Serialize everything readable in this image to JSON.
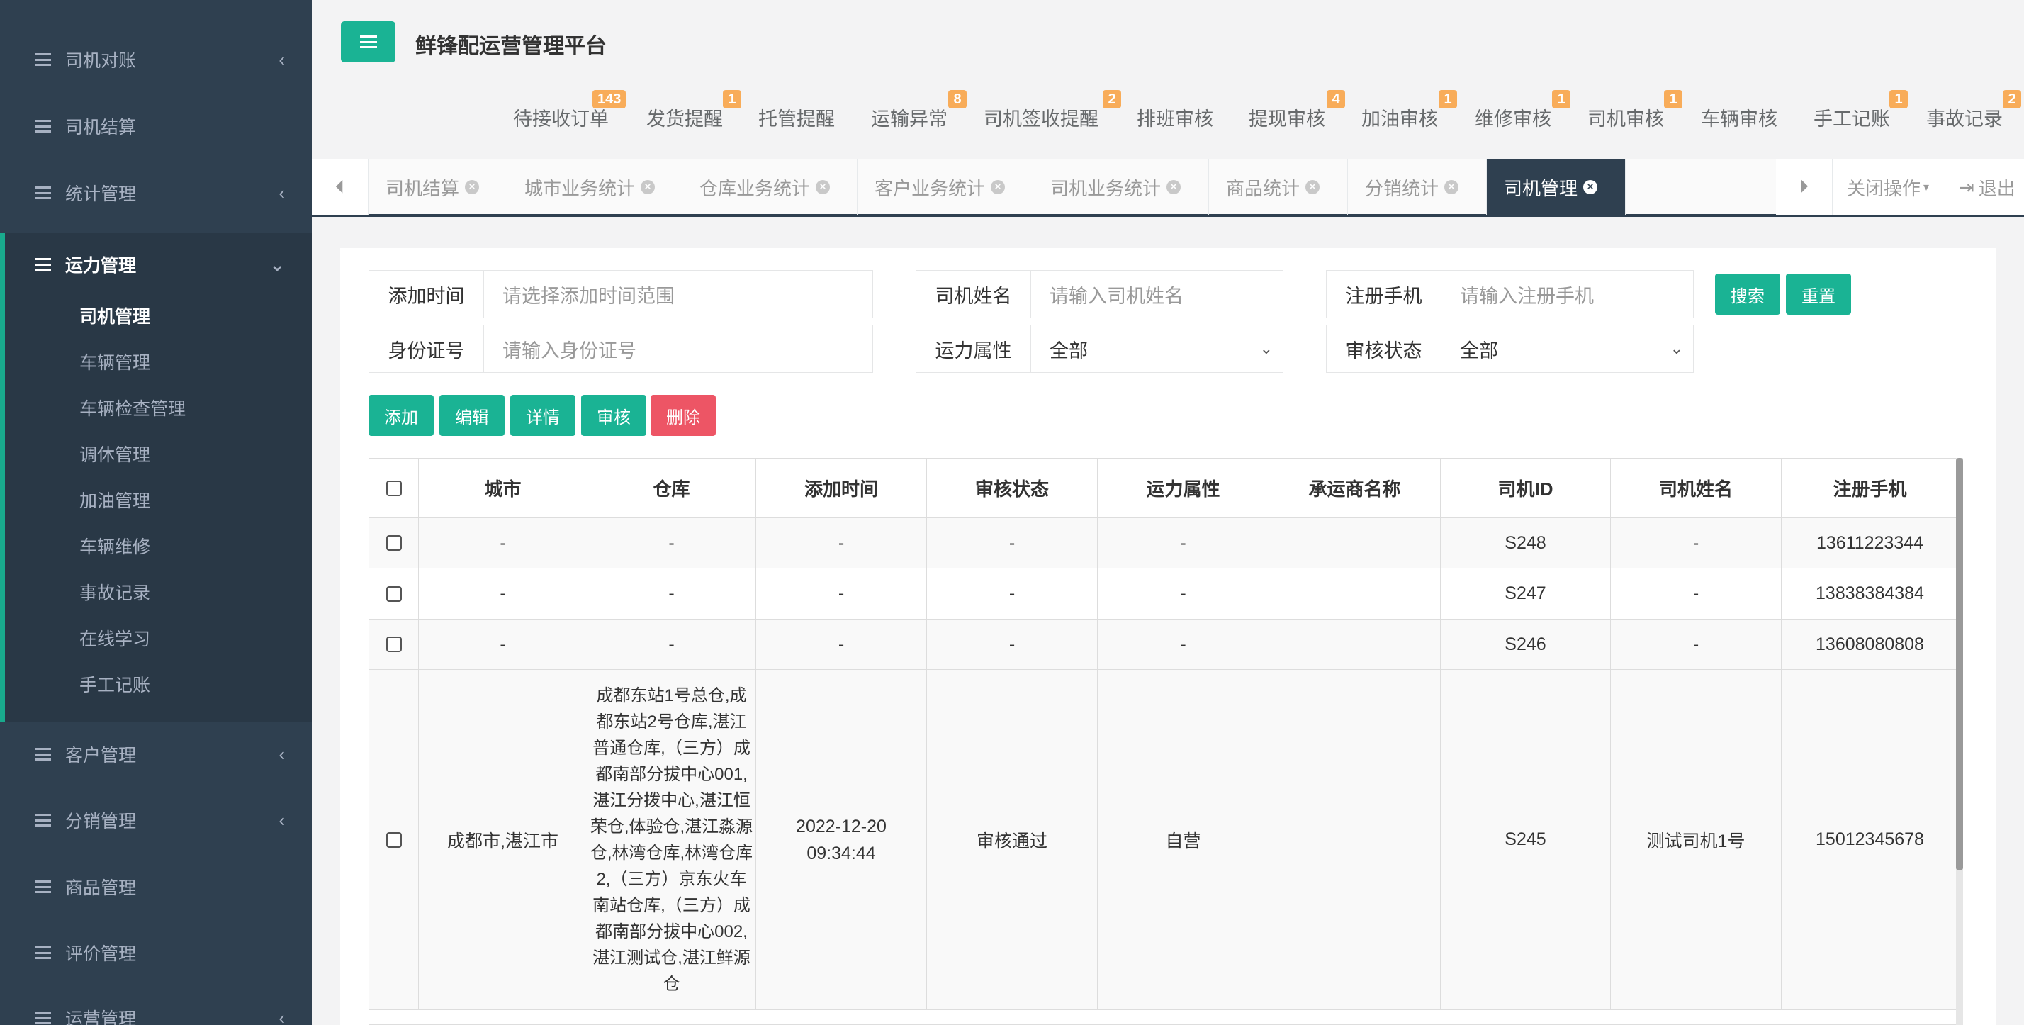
{
  "app": {
    "title": "鲜锋配运营管理平台"
  },
  "sidebar": {
    "items": [
      {
        "label": "司机对账",
        "chevron": "‹"
      },
      {
        "label": "司机结算",
        "chevron": ""
      },
      {
        "label": "统计管理",
        "chevron": "‹"
      },
      {
        "label": "运力管理",
        "chevron": "⌄"
      },
      {
        "label": "客户管理",
        "chevron": "‹"
      },
      {
        "label": "分销管理",
        "chevron": "‹"
      },
      {
        "label": "商品管理",
        "chevron": ""
      },
      {
        "label": "评价管理",
        "chevron": ""
      },
      {
        "label": "运营管理",
        "chevron": "‹"
      }
    ],
    "sub_items": [
      "司机管理",
      "车辆管理",
      "车辆检查管理",
      "调休管理",
      "加油管理",
      "车辆维修",
      "事故记录",
      "在线学习",
      "手工记账"
    ]
  },
  "notifications": [
    {
      "label": "待接收订单",
      "count": "143"
    },
    {
      "label": "发货提醒",
      "count": "1"
    },
    {
      "label": "托管提醒",
      "count": ""
    },
    {
      "label": "运输异常",
      "count": "8"
    },
    {
      "label": "司机签收提醒",
      "count": "2"
    },
    {
      "label": "排班审核",
      "count": ""
    },
    {
      "label": "提现审核",
      "count": "4"
    },
    {
      "label": "加油审核",
      "count": "1"
    },
    {
      "label": "维修审核",
      "count": "1"
    },
    {
      "label": "司机审核",
      "count": "1"
    },
    {
      "label": "车辆审核",
      "count": ""
    },
    {
      "label": "手工记账",
      "count": "1"
    },
    {
      "label": "事故记录",
      "count": "2"
    }
  ],
  "tabs": [
    {
      "label": "司机结算"
    },
    {
      "label": "城市业务统计"
    },
    {
      "label": "仓库业务统计"
    },
    {
      "label": "客户业务统计"
    },
    {
      "label": "司机业务统计"
    },
    {
      "label": "商品统计"
    },
    {
      "label": "分销统计"
    },
    {
      "label": "司机管理"
    }
  ],
  "tab_actions": {
    "close_ops": "关闭操作",
    "logout": "退出"
  },
  "filters": {
    "add_time": {
      "label": "添加时间",
      "placeholder": "请选择添加时间范围"
    },
    "driver_name": {
      "label": "司机姓名",
      "placeholder": "请输入司机姓名"
    },
    "phone": {
      "label": "注册手机",
      "placeholder": "请输入注册手机"
    },
    "id_number": {
      "label": "身份证号",
      "placeholder": "请输入身份证号"
    },
    "capacity": {
      "label": "运力属性",
      "value": "全部"
    },
    "audit": {
      "label": "审核状态",
      "value": "全部"
    },
    "search_label": "搜索",
    "reset_label": "重置"
  },
  "toolbar": {
    "add": "添加",
    "edit": "编辑",
    "detail": "详情",
    "audit": "审核",
    "delete": "删除"
  },
  "table": {
    "columns": [
      "城市",
      "仓库",
      "添加时间",
      "审核状态",
      "运力属性",
      "承运商名称",
      "司机ID",
      "司机姓名",
      "注册手机"
    ],
    "rows": [
      {
        "city": "-",
        "warehouse": "-",
        "added": "-",
        "audit": "-",
        "capacity": "-",
        "carrier": "",
        "driver_id": "S248",
        "name": "-",
        "phone": "13611223344"
      },
      {
        "city": "-",
        "warehouse": "-",
        "added": "-",
        "audit": "-",
        "capacity": "-",
        "carrier": "",
        "driver_id": "S247",
        "name": "-",
        "phone": "13838384384"
      },
      {
        "city": "-",
        "warehouse": "-",
        "added": "-",
        "audit": "-",
        "capacity": "-",
        "carrier": "",
        "driver_id": "S246",
        "name": "-",
        "phone": "13608080808"
      },
      {
        "city": "成都市,湛江市",
        "warehouse": "成都东站1号总仓,成都东站2号仓库,湛江普通仓库,（三方）成都南部分拔中心001,湛江分拨中心,湛江恒荣仓,体验仓,湛江淼源仓,林湾仓库,林湾仓库2,（三方）京东火车南站仓库,（三方）成都南部分拔中心002,湛江测试仓,湛江鲜源仓",
        "added_date": "2022-12-20",
        "added_time": "09:34:44",
        "audit": "审核通过",
        "capacity": "自营",
        "carrier": "",
        "driver_id": "S245",
        "name": "测试司机1号",
        "phone": "15012345678"
      }
    ]
  }
}
